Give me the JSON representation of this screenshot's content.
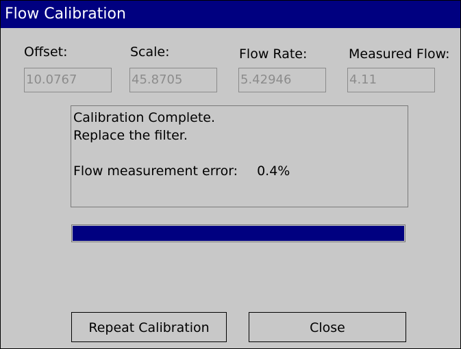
{
  "window": {
    "title": "Flow Calibration"
  },
  "fields": {
    "offset": {
      "label": "Offset:",
      "value": "10.0767"
    },
    "scale": {
      "label": "Scale:",
      "value": "45.8705"
    },
    "flow_rate": {
      "label": "Flow Rate:",
      "value": "5.42946"
    },
    "measured_flow": {
      "label": "Measured Flow:",
      "value": "4.11"
    }
  },
  "message": {
    "line1": "Calibration Complete.",
    "line2": "Replace the filter.",
    "error_label": "Flow measurement error:",
    "error_value": "0.4%"
  },
  "progress": {
    "percent": 100,
    "color": "#000080"
  },
  "buttons": {
    "repeat": "Repeat Calibration",
    "close": "Close"
  },
  "colors": {
    "titlebar": "#000080",
    "background": "#c8c8c8"
  }
}
